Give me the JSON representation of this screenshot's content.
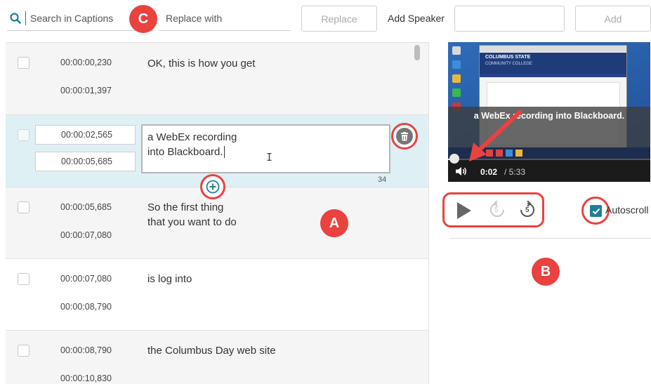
{
  "toolbar": {
    "search_placeholder": "Search in Captions",
    "replace_placeholder": "Replace with",
    "replace_button": "Replace",
    "add_speaker_label": "Add Speaker",
    "add_button": "Add"
  },
  "annotations": {
    "a": "A",
    "b": "B",
    "c": "C"
  },
  "captions": [
    {
      "start": "00:00:00,230",
      "end": "00:00:01,397",
      "text": "OK, this is how you get"
    },
    {
      "start": "00:00:02,565",
      "end": "00:00:05,685",
      "line1": "a WebEx recording",
      "line2": "into Blackboard.",
      "char_count": "34"
    },
    {
      "start": "00:00:05,685",
      "end": "00:00:07,080",
      "line1": "So the first thing",
      "line2": "that you want to do"
    },
    {
      "start": "00:00:07,080",
      "end": "00:00:08,790",
      "text": "is log into"
    },
    {
      "start": "00:00:08,790",
      "end": "00:00:10,830",
      "text": "the Columbus Day web site"
    }
  ],
  "player": {
    "caption_overlay": "a WebEx recording into Blackboard.",
    "current_time": "0:02",
    "duration": "/ 5:33",
    "site_title": "COLUMBUS STATE",
    "site_subtitle": "COMMUNITY COLLEGE",
    "skip_back_seconds": "5",
    "skip_forward_seconds": "5"
  },
  "autoscroll": {
    "label": "Autoscroll",
    "checked": true
  },
  "colors": {
    "accent": "#1f7f95",
    "annotation_red": "#e9423f",
    "active_row": "#dff0f5"
  }
}
